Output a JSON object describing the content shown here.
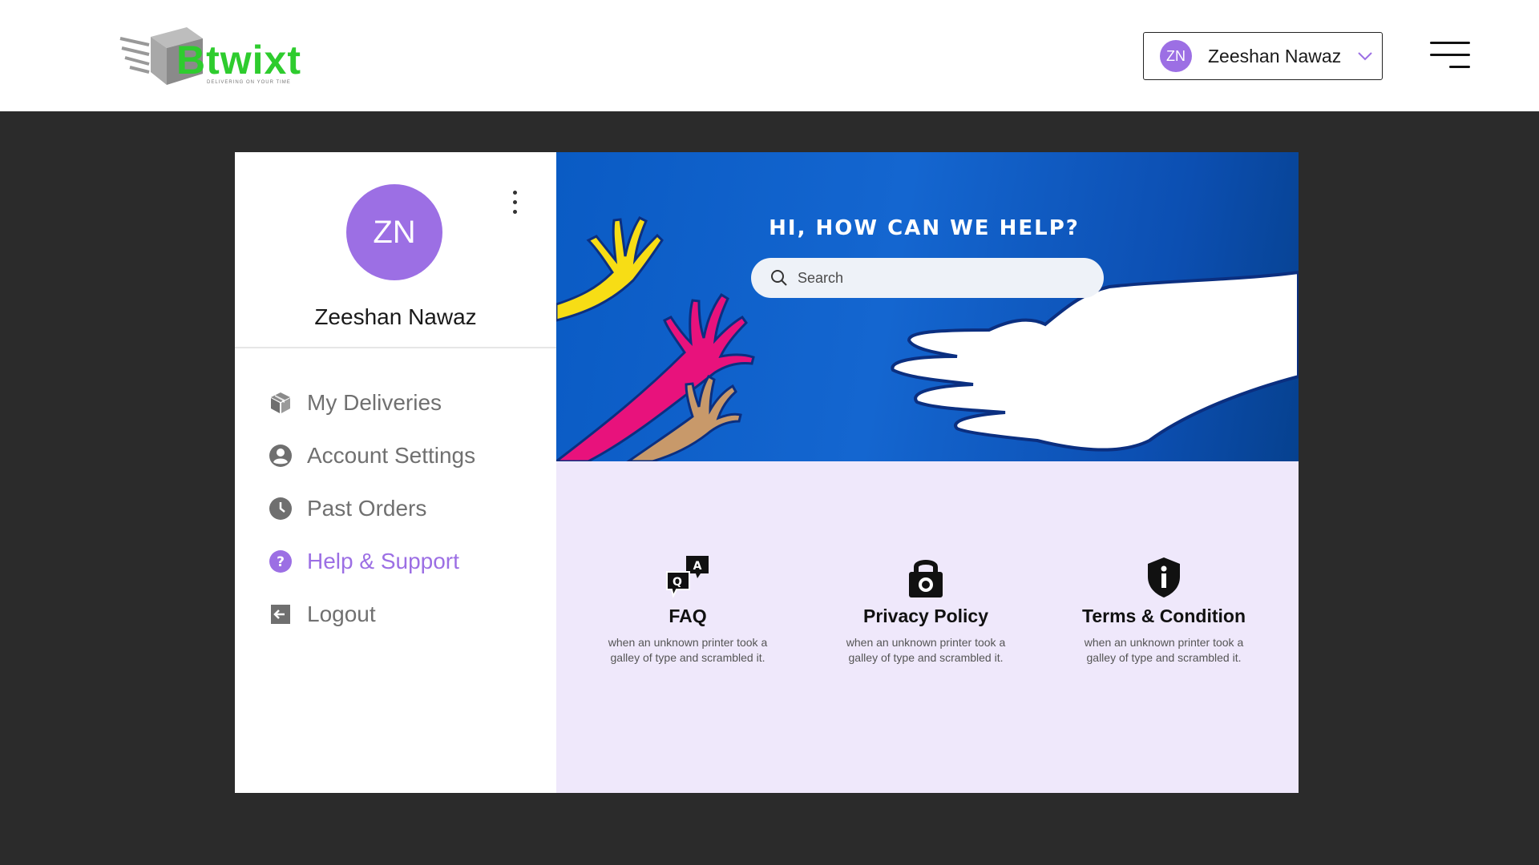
{
  "header": {
    "logo_text": "Btwixt",
    "logo_tagline": "DELIVERING ON YOUR TIME",
    "user": {
      "initials": "ZN",
      "name": "Zeeshan Nawaz"
    }
  },
  "profile": {
    "initials": "ZN",
    "name": "Zeeshan Nawaz"
  },
  "sidebar": {
    "items": [
      {
        "label": "My Deliveries",
        "icon": "box-icon",
        "active": false
      },
      {
        "label": "Account Settings",
        "icon": "user-circle-icon",
        "active": false
      },
      {
        "label": "Past Orders",
        "icon": "clock-icon",
        "active": false
      },
      {
        "label": "Help & Support",
        "icon": "question-icon",
        "active": true
      },
      {
        "label": "Logout",
        "icon": "logout-icon",
        "active": false
      }
    ]
  },
  "hero": {
    "title": "HI, HOW CAN WE HELP?",
    "search_placeholder": "Search"
  },
  "features": [
    {
      "title": "FAQ",
      "description": "when an unknown printer took a galley of type and scrambled it.",
      "icon": "qa-chat-icon"
    },
    {
      "title": "Privacy Policy",
      "description": "when an unknown printer took a galley of type and scrambled it.",
      "icon": "lock-icon"
    },
    {
      "title": "Terms & Condition",
      "description": "when an unknown printer took a galley of type and scrambled it.",
      "icon": "shield-info-icon"
    }
  ],
  "colors": {
    "accent": "#9c6fe4",
    "background": "#2b2b2b",
    "panel": "#efe8fb",
    "hero_blue": "#0a5bc4",
    "logo_green": "#2ecc2e"
  }
}
